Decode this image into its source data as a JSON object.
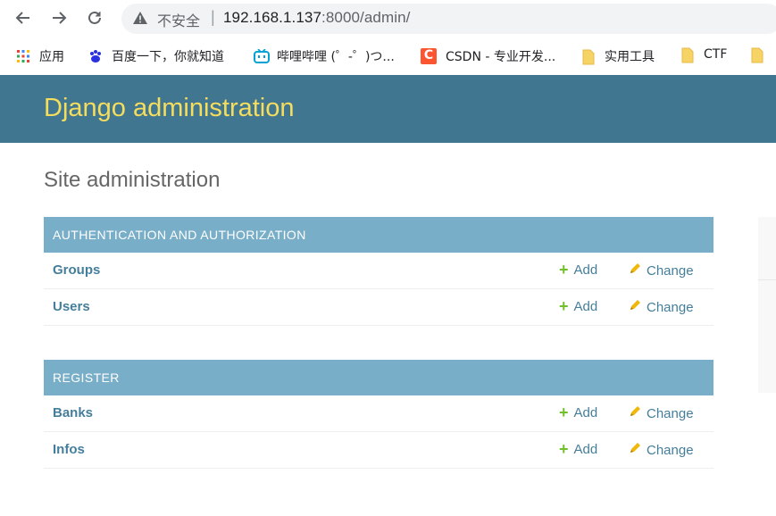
{
  "browser": {
    "insecure_label": "不安全",
    "separator": "|",
    "url_host": "192.168.1.137",
    "url_rest": ":8000/admin/"
  },
  "bookmarks": [
    {
      "label": "应用",
      "icon": "apps-grid-icon"
    },
    {
      "label": "百度一下，你就知道",
      "icon": "baidu-paw-icon"
    },
    {
      "label": "哔哩哔哩 (゜-゜)つ...",
      "icon": "bilibili-tv-icon"
    },
    {
      "label": "CSDN - 专业开发...",
      "icon": "csdn-c-icon"
    },
    {
      "label": "实用工具",
      "icon": "folder-icon"
    },
    {
      "label": "CTF",
      "icon": "folder-icon"
    }
  ],
  "header": {
    "brand": "Django administration"
  },
  "page": {
    "title": "Site administration"
  },
  "apps": [
    {
      "caption": "AUTHENTICATION AND AUTHORIZATION",
      "models": [
        {
          "name": "Groups",
          "add": "Add",
          "change": "Change"
        },
        {
          "name": "Users",
          "add": "Add",
          "change": "Change"
        }
      ]
    },
    {
      "caption": "REGISTER",
      "models": [
        {
          "name": "Banks",
          "add": "Add",
          "change": "Change"
        },
        {
          "name": "Infos",
          "add": "Add",
          "change": "Change"
        }
      ]
    }
  ],
  "colors": {
    "header_bg": "#417690",
    "brand": "#f5dd5d",
    "caption_bg": "#79aec8",
    "link": "#447e9b",
    "add_green": "#70bf2b",
    "pencil": "#efb80b"
  }
}
